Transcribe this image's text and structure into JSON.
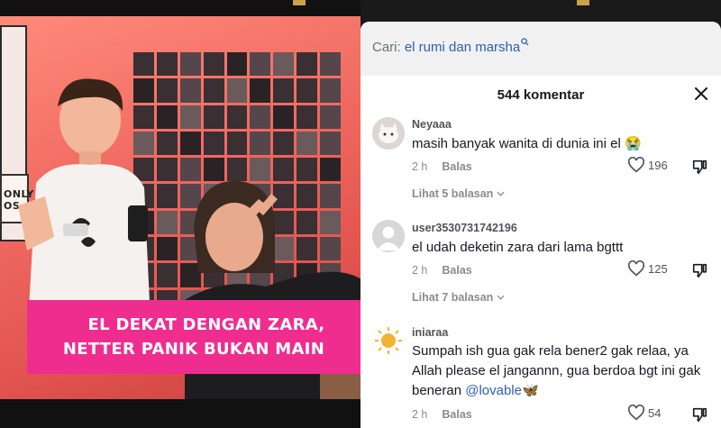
{
  "video": {
    "sign_text": "ONLY\nOS",
    "caption_line1": "EL DEKAT DENGAN ZARA,",
    "caption_line2": "NETTER PANIK BUKAN MAIN"
  },
  "search": {
    "prefix": "Cari:",
    "query": "el rumi dan marsha"
  },
  "comments_panel": {
    "count_label": "544 komentar"
  },
  "comments": [
    {
      "username": "Neyaaa",
      "text": "masih banyak wanita di dunia ini el 😭",
      "time": "2 h",
      "reply_label": "Balas",
      "likes": "196",
      "view_replies": "Lihat 5 balasan"
    },
    {
      "username": "user3530731742196",
      "text": "el udah deketin zara dari lama bgttt",
      "time": "2 h",
      "reply_label": "Balas",
      "likes": "125",
      "view_replies": "Lihat 7 balasan"
    },
    {
      "username": "iniaraa",
      "text": "Sumpah ish gua gak rela bener2 gak relaa, ya Allah please el jangannn, gua berdoa bgt ini gak beneran ",
      "mention": "@lovable🦋",
      "time": "2 h",
      "reply_label": "Balas",
      "likes": "54"
    }
  ],
  "colors": {
    "caption_bg": "#ee2d8f",
    "link_blue": "#2f5fb3",
    "video_bg": "#f06a62"
  }
}
